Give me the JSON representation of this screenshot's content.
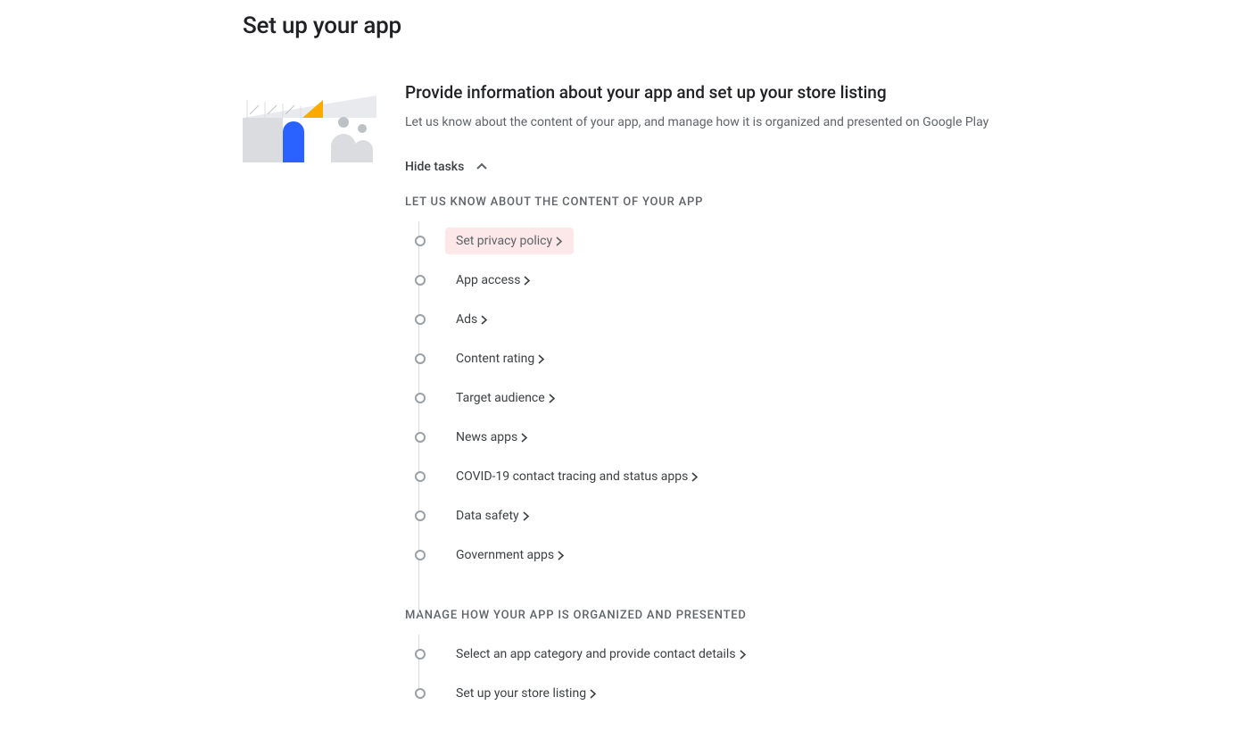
{
  "page": {
    "title": "Set up your app"
  },
  "section": {
    "title": "Provide information about your app and set up your store listing",
    "description": "Let us know about the content of your app, and manage how it is organized and presented on Google Play",
    "hide_tasks_label": "Hide tasks"
  },
  "groups": [
    {
      "label": "LET US KNOW ABOUT THE CONTENT OF YOUR APP",
      "continues": true,
      "tasks": [
        {
          "label": "Set privacy policy",
          "highlighted": true
        },
        {
          "label": "App access"
        },
        {
          "label": "Ads"
        },
        {
          "label": "Content rating"
        },
        {
          "label": "Target audience"
        },
        {
          "label": "News apps"
        },
        {
          "label": "COVID-19 contact tracing and status apps"
        },
        {
          "label": "Data safety"
        },
        {
          "label": "Government apps"
        }
      ]
    },
    {
      "label": "MANAGE HOW YOUR APP IS ORGANIZED AND PRESENTED",
      "continues": false,
      "tasks": [
        {
          "label": "Select an app category and provide contact details"
        },
        {
          "label": "Set up your store listing"
        }
      ]
    }
  ]
}
